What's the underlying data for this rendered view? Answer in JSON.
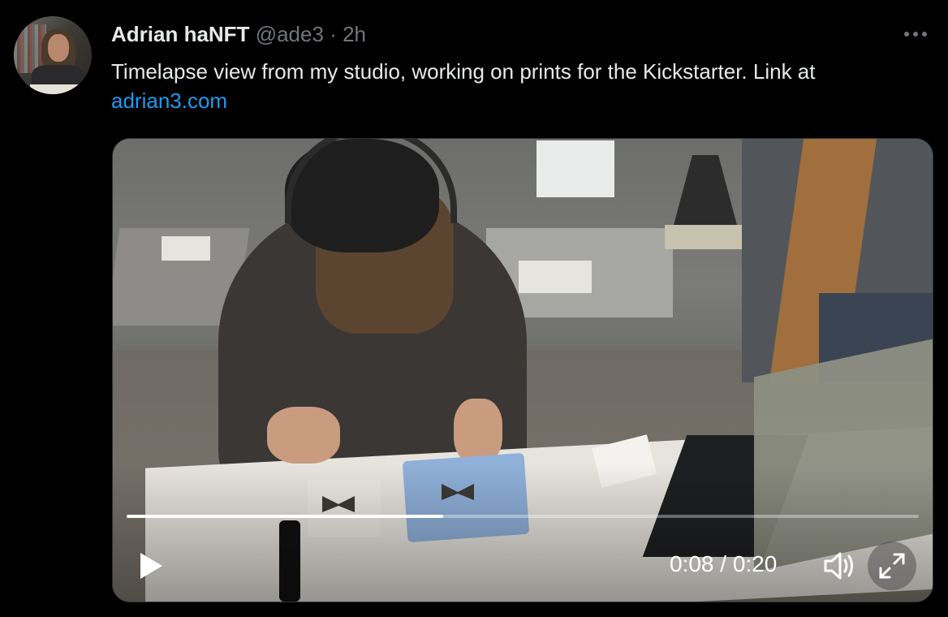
{
  "tweet": {
    "author_name": "Adrian haNFT",
    "handle": "@ade3",
    "separator": "·",
    "time": "2h",
    "more_icon": "more-icon",
    "text": "Timelapse view from my studio, working on prints for the Kickstarter. Link at",
    "link": "adrian3.com"
  },
  "video": {
    "current_time": "0:08",
    "separator": "/",
    "duration": "0:20",
    "progress": 0.4,
    "icons": {
      "play": "play-icon",
      "volume": "volume-icon",
      "fullscreen": "fullscreen-icon"
    }
  },
  "colors": {
    "background": "#000000",
    "text": "#e7e9ea",
    "muted": "#71767b",
    "link": "#1d9bf0"
  }
}
